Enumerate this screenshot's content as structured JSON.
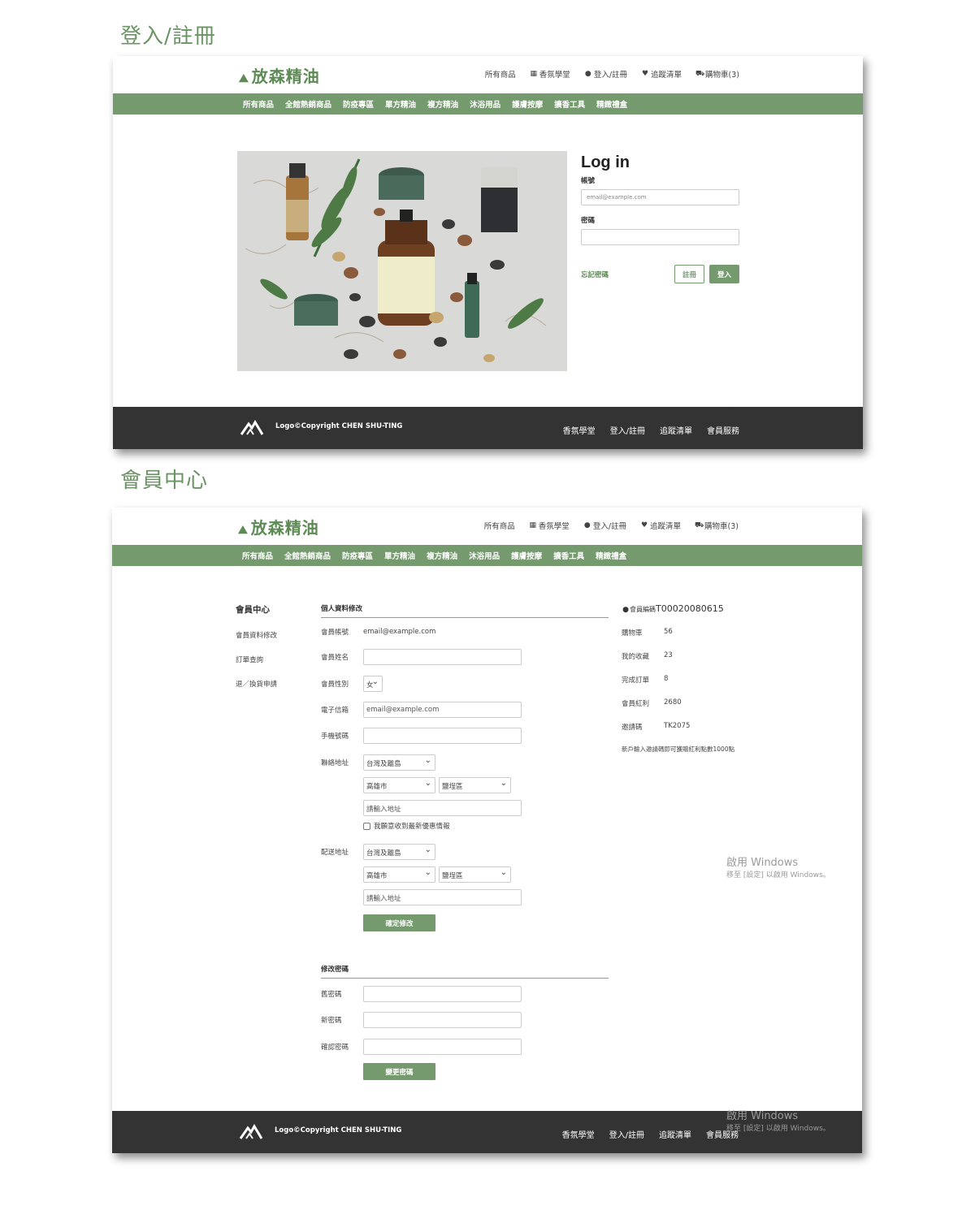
{
  "colors": {
    "accent": "#749a6d",
    "footer": "#333333"
  },
  "site": {
    "logo_text": "放森精油",
    "top_nav": [
      "所有商品",
      "香氛學堂",
      "登入/註冊",
      "追蹤清單",
      "購物車(3)"
    ],
    "top_nav_icons": [
      "",
      "store-icon",
      "user-icon",
      "heart-icon",
      "cart-icon"
    ],
    "categories": [
      "所有商品",
      "全館熱銷商品",
      "防疫專區",
      "單方精油",
      "複方精油",
      "沐浴用品",
      "護膚按摩",
      "擴香工具",
      "精緻禮盒"
    ],
    "footer_copy": "Logo©Copyright CHEN SHU-TING",
    "footer_nav": [
      "香氛學堂",
      "登入/註冊",
      "追蹤清單",
      "會員服務"
    ],
    "watermark_line1": "啟用 Windows",
    "watermark_line2": "移至 [設定] 以啟用 Windows。"
  },
  "login_section": {
    "title": "登入/註冊",
    "heading": "Log in",
    "account_label": "帳號",
    "account_placeholder": "email@example.com",
    "password_label": "密碼",
    "forgot_link": "忘記密碼",
    "register_button": "註冊",
    "login_button": "登入"
  },
  "member_section": {
    "title": "會員中心",
    "sidebar": {
      "title": "會員中心",
      "items": [
        "會員資料修改",
        "訂單查詢",
        "退／換貨申請"
      ]
    },
    "profile": {
      "title": "個人資料修改",
      "account_label": "會員帳號",
      "account_value": "email@example.com",
      "name_label": "會員姓名",
      "gender_label": "會員性別",
      "gender_value": "女",
      "email_label": "電子信箱",
      "email_value": "email@example.com",
      "phone_label": "手機號碼",
      "contact_label": "聯絡地址",
      "region_value": "台灣及離島",
      "city_value": "高雄市",
      "district_value": "鹽埕區",
      "address_placeholder": "請輸入地址",
      "newsletter_label": "我願意收到最新優惠情報",
      "shipping_label": "配送地址",
      "confirm_button": "確定修改"
    },
    "password": {
      "title": "修改密碼",
      "old_label": "舊密碼",
      "new_label": "新密碼",
      "confirm_label": "確認密碼",
      "change_button": "變更密碼"
    },
    "member_info": {
      "id_prefix": "會員編碼",
      "id_value": "T00020080615",
      "rows": [
        {
          "label": "購物車",
          "value": "56"
        },
        {
          "label": "我的收藏",
          "value": "23"
        },
        {
          "label": "完成訂單",
          "value": "8"
        },
        {
          "label": "會員紅利",
          "value": "2680"
        },
        {
          "label": "邀請碼",
          "value": "TK2075"
        }
      ],
      "note": "新戶輸入邀請碼即可獲贈紅利點數1000點"
    }
  }
}
